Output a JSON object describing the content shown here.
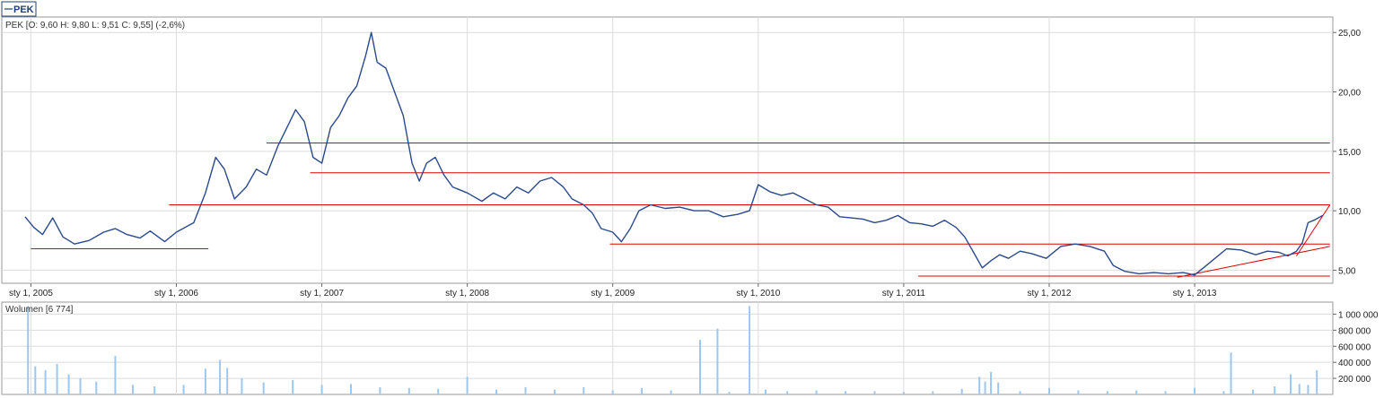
{
  "legend": {
    "symbol": "PEK"
  },
  "price_panel": {
    "info": "PEK [O: 9,60  H: 9,80  L: 9,51  C: 9,55] (-2,6%)"
  },
  "volume_panel": {
    "info": "Wolumen [6 774]"
  },
  "colors": {
    "price_line": "#2b4a8b",
    "volume_bar": "#9cc7ee",
    "trend_line": "#e00000",
    "grid": "#dcdcdc",
    "frame": "#9a9a9a"
  },
  "chart_data": [
    {
      "type": "line",
      "title": "PEK [O: 9,60  H: 9,80  L: 9,51  C: 9,55] (-2,6%)",
      "series": [
        {
          "name": "PEK",
          "points": [
            [
              2004.96,
              9.5
            ],
            [
              2005.02,
              8.6
            ],
            [
              2005.08,
              8.0
            ],
            [
              2005.15,
              9.4
            ],
            [
              2005.22,
              7.8
            ],
            [
              2005.3,
              7.2
            ],
            [
              2005.4,
              7.5
            ],
            [
              2005.5,
              8.2
            ],
            [
              2005.58,
              8.5
            ],
            [
              2005.66,
              8.0
            ],
            [
              2005.75,
              7.7
            ],
            [
              2005.82,
              8.3
            ],
            [
              2005.92,
              7.4
            ],
            [
              2006.0,
              8.2
            ],
            [
              2006.12,
              9.0
            ],
            [
              2006.2,
              11.5
            ],
            [
              2006.27,
              14.5
            ],
            [
              2006.33,
              13.5
            ],
            [
              2006.4,
              11.0
            ],
            [
              2006.48,
              12.0
            ],
            [
              2006.55,
              13.5
            ],
            [
              2006.62,
              13.0
            ],
            [
              2006.7,
              15.5
            ],
            [
              2006.76,
              17.0
            ],
            [
              2006.82,
              18.5
            ],
            [
              2006.88,
              17.5
            ],
            [
              2006.94,
              14.5
            ],
            [
              2007.0,
              14.0
            ],
            [
              2007.06,
              17.0
            ],
            [
              2007.12,
              18.0
            ],
            [
              2007.18,
              19.5
            ],
            [
              2007.24,
              20.5
            ],
            [
              2007.3,
              23.0
            ],
            [
              2007.34,
              25.0
            ],
            [
              2007.38,
              22.5
            ],
            [
              2007.44,
              22.0
            ],
            [
              2007.5,
              20.0
            ],
            [
              2007.56,
              18.0
            ],
            [
              2007.62,
              14.0
            ],
            [
              2007.67,
              12.5
            ],
            [
              2007.72,
              14.0
            ],
            [
              2007.78,
              14.5
            ],
            [
              2007.84,
              13.0
            ],
            [
              2007.9,
              12.0
            ],
            [
              2008.0,
              11.5
            ],
            [
              2008.1,
              10.8
            ],
            [
              2008.18,
              11.5
            ],
            [
              2008.26,
              11.0
            ],
            [
              2008.34,
              12.0
            ],
            [
              2008.42,
              11.5
            ],
            [
              2008.5,
              12.5
            ],
            [
              2008.58,
              12.8
            ],
            [
              2008.66,
              12.0
            ],
            [
              2008.72,
              11.0
            ],
            [
              2008.8,
              10.5
            ],
            [
              2008.86,
              9.8
            ],
            [
              2008.92,
              8.5
            ],
            [
              2009.0,
              8.2
            ],
            [
              2009.06,
              7.4
            ],
            [
              2009.12,
              8.5
            ],
            [
              2009.18,
              10.0
            ],
            [
              2009.26,
              10.5
            ],
            [
              2009.36,
              10.2
            ],
            [
              2009.46,
              10.3
            ],
            [
              2009.56,
              10.0
            ],
            [
              2009.66,
              10.0
            ],
            [
              2009.76,
              9.5
            ],
            [
              2009.86,
              9.7
            ],
            [
              2009.94,
              10.0
            ],
            [
              2010.0,
              12.2
            ],
            [
              2010.08,
              11.6
            ],
            [
              2010.16,
              11.3
            ],
            [
              2010.24,
              11.5
            ],
            [
              2010.32,
              11.0
            ],
            [
              2010.4,
              10.5
            ],
            [
              2010.48,
              10.3
            ],
            [
              2010.56,
              9.5
            ],
            [
              2010.64,
              9.4
            ],
            [
              2010.72,
              9.3
            ],
            [
              2010.8,
              9.0
            ],
            [
              2010.88,
              9.2
            ],
            [
              2010.96,
              9.6
            ],
            [
              2011.04,
              9.0
            ],
            [
              2011.12,
              8.9
            ],
            [
              2011.2,
              8.7
            ],
            [
              2011.28,
              9.2
            ],
            [
              2011.36,
              8.6
            ],
            [
              2011.42,
              7.8
            ],
            [
              2011.48,
              6.5
            ],
            [
              2011.54,
              5.2
            ],
            [
              2011.6,
              5.8
            ],
            [
              2011.66,
              6.3
            ],
            [
              2011.72,
              6.0
            ],
            [
              2011.8,
              6.6
            ],
            [
              2011.88,
              6.4
            ],
            [
              2011.98,
              6.0
            ],
            [
              2012.08,
              7.0
            ],
            [
              2012.18,
              7.2
            ],
            [
              2012.28,
              7.0
            ],
            [
              2012.38,
              6.6
            ],
            [
              2012.44,
              5.4
            ],
            [
              2012.52,
              4.9
            ],
            [
              2012.62,
              4.7
            ],
            [
              2012.72,
              4.8
            ],
            [
              2012.82,
              4.7
            ],
            [
              2012.92,
              4.8
            ],
            [
              2013.0,
              4.6
            ],
            [
              2013.06,
              5.2
            ],
            [
              2013.14,
              6.0
            ],
            [
              2013.22,
              6.8
            ],
            [
              2013.32,
              6.7
            ],
            [
              2013.42,
              6.3
            ],
            [
              2013.5,
              6.6
            ],
            [
              2013.58,
              6.5
            ],
            [
              2013.64,
              6.2
            ],
            [
              2013.7,
              6.6
            ],
            [
              2013.74,
              7.3
            ],
            [
              2013.78,
              9.0
            ],
            [
              2013.82,
              9.2
            ],
            [
              2013.88,
              9.6
            ]
          ]
        }
      ],
      "ylim": [
        3.9,
        26.3
      ],
      "yticks": [
        "5,00",
        "10,00",
        "15,00",
        "20,00",
        "25,00"
      ],
      "ytick_values": [
        5,
        10,
        15,
        20,
        25
      ],
      "x_date_range": [
        2004.8,
        2013.95
      ],
      "xticks": [
        "sty 1, 2005",
        "sty 1, 2006",
        "sty 1, 2007",
        "sty 1, 2008",
        "sty 1, 2009",
        "sty 1, 2010",
        "sty 1, 2011",
        "sty 1, 2012",
        "sty 1, 2013"
      ],
      "xtick_values": [
        2005.0,
        2006.0,
        2007.0,
        2008.0,
        2009.0,
        2010.0,
        2011.0,
        2012.0,
        2013.0
      ],
      "grid": true,
      "trend_lines": [
        {
          "x": [
            2005.0,
            2006.22
          ],
          "y": [
            6.8,
            6.8
          ]
        },
        {
          "x": [
            2005.95,
            2013.93
          ],
          "y": [
            10.5,
            10.5
          ]
        },
        {
          "x": [
            2006.62,
            2013.93
          ],
          "y": [
            15.7,
            15.7
          ]
        },
        {
          "x": [
            2006.92,
            2013.93
          ],
          "y": [
            13.2,
            13.2
          ]
        },
        {
          "x": [
            2008.98,
            2013.93
          ],
          "y": [
            7.2,
            7.2
          ]
        },
        {
          "x": [
            2011.1,
            2013.93
          ],
          "y": [
            4.5,
            4.5
          ]
        },
        {
          "x": [
            2012.88,
            2013.93
          ],
          "y": [
            4.4,
            7.0
          ]
        },
        {
          "x": [
            2013.7,
            2013.93
          ],
          "y": [
            6.2,
            10.5
          ]
        }
      ]
    },
    {
      "type": "bar",
      "title": "Wolumen [6 774]",
      "series": [
        {
          "name": "Wolumen",
          "points": [
            [
              2004.98,
              1100000
            ],
            [
              2005.03,
              350000
            ],
            [
              2005.1,
              300000
            ],
            [
              2005.18,
              380000
            ],
            [
              2005.26,
              250000
            ],
            [
              2005.34,
              200000
            ],
            [
              2005.45,
              160000
            ],
            [
              2005.58,
              480000
            ],
            [
              2005.7,
              120000
            ],
            [
              2005.85,
              100000
            ],
            [
              2006.05,
              120000
            ],
            [
              2006.2,
              320000
            ],
            [
              2006.3,
              430000
            ],
            [
              2006.35,
              330000
            ],
            [
              2006.45,
              200000
            ],
            [
              2006.6,
              150000
            ],
            [
              2006.8,
              180000
            ],
            [
              2007.0,
              120000
            ],
            [
              2007.2,
              130000
            ],
            [
              2007.4,
              90000
            ],
            [
              2007.6,
              80000
            ],
            [
              2007.8,
              70000
            ],
            [
              2008.0,
              220000
            ],
            [
              2008.2,
              60000
            ],
            [
              2008.4,
              90000
            ],
            [
              2008.6,
              60000
            ],
            [
              2008.8,
              90000
            ],
            [
              2009.0,
              50000
            ],
            [
              2009.2,
              80000
            ],
            [
              2009.4,
              50000
            ],
            [
              2009.6,
              680000
            ],
            [
              2009.72,
              820000
            ],
            [
              2009.8,
              30000
            ],
            [
              2009.94,
              1100000
            ],
            [
              2010.05,
              60000
            ],
            [
              2010.2,
              40000
            ],
            [
              2010.4,
              50000
            ],
            [
              2010.6,
              40000
            ],
            [
              2010.8,
              40000
            ],
            [
              2011.0,
              30000
            ],
            [
              2011.2,
              40000
            ],
            [
              2011.4,
              70000
            ],
            [
              2011.52,
              220000
            ],
            [
              2011.56,
              160000
            ],
            [
              2011.6,
              280000
            ],
            [
              2011.65,
              150000
            ],
            [
              2011.8,
              40000
            ],
            [
              2012.0,
              80000
            ],
            [
              2012.2,
              50000
            ],
            [
              2012.4,
              40000
            ],
            [
              2012.6,
              50000
            ],
            [
              2012.8,
              40000
            ],
            [
              2013.0,
              80000
            ],
            [
              2013.2,
              40000
            ],
            [
              2013.25,
              520000
            ],
            [
              2013.4,
              60000
            ],
            [
              2013.55,
              100000
            ],
            [
              2013.66,
              250000
            ],
            [
              2013.72,
              130000
            ],
            [
              2013.78,
              120000
            ],
            [
              2013.84,
              300000
            ]
          ]
        }
      ],
      "ylim": [
        0,
        1150000
      ],
      "yticks": [
        "200 000",
        "400 000",
        "600 000",
        "800 000",
        "1 000 000"
      ],
      "ytick_values": [
        200000,
        400000,
        600000,
        800000,
        1000000
      ],
      "grid": true
    }
  ]
}
